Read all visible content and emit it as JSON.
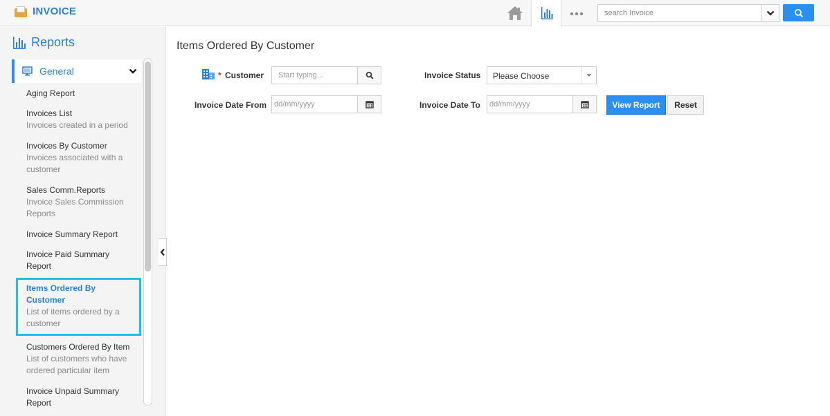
{
  "app": {
    "title": "INVOICE"
  },
  "topbar": {
    "search_placeholder": "search Invoice",
    "icons": [
      "home-icon",
      "bar-chart-icon",
      "more-icon",
      "chevron-down-icon",
      "search-icon"
    ]
  },
  "sidebar": {
    "heading": "Reports",
    "group": "General",
    "items": [
      {
        "title": "Aging Report",
        "desc": ""
      },
      {
        "title": "Invoices List",
        "desc": "Invoices created in a period"
      },
      {
        "title": "Invoices By Customer",
        "desc": "Invoices associated with a customer"
      },
      {
        "title": "Sales Comm.Reports",
        "desc": "Invoice Sales Commission Reports"
      },
      {
        "title": "Invoice Summary Report",
        "desc": ""
      },
      {
        "title": "Invoice Paid Summary Report",
        "desc": ""
      },
      {
        "title": "Items Ordered By Customer",
        "desc": "List of items ordered by a customer"
      },
      {
        "title": "Customers Ordered By Item",
        "desc": "List of customers who have ordered particular item"
      },
      {
        "title": "Invoice Unpaid Summary Report",
        "desc": ""
      }
    ],
    "active_index": 6
  },
  "main": {
    "title": "Items Ordered By Customer",
    "form": {
      "customer_label": "Customer",
      "required_mark": "*",
      "customer_placeholder": "Start typing...",
      "status_label": "Invoice Status",
      "status_value": "Please Choose",
      "date_from_label": "Invoice Date From",
      "date_from_placeholder": "dd/mm/yyyy",
      "date_to_label": "Invoice Date To",
      "date_to_placeholder": "dd/mm/yyyy",
      "view_button": "View Report",
      "reset_button": "Reset"
    }
  },
  "colors": {
    "accent": "#2a8ff0",
    "brand_text": "#2f7fd1",
    "active_border": "#1ec0e8",
    "required": "#e0302a"
  }
}
